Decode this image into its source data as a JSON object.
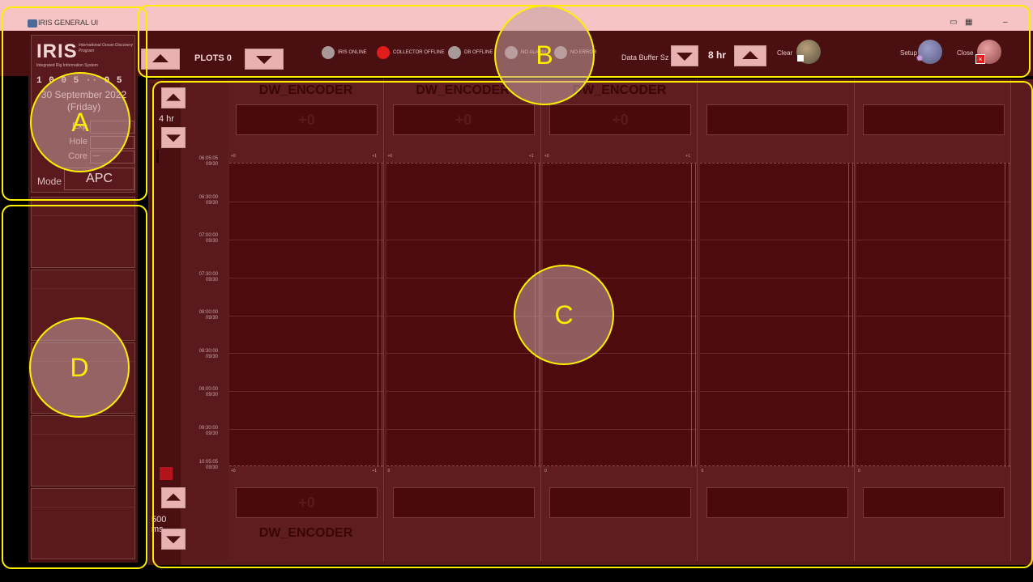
{
  "window": {
    "title": "IRIS GENERAL UI"
  },
  "topbar": {
    "plots_label": "PLOTS 0",
    "status": [
      {
        "label": "IRIS ONLINE",
        "color": "#a99a9a"
      },
      {
        "label": "COLLECTOR OFFLINE",
        "color": "#e21b1b"
      },
      {
        "label": "DB OFFLINE",
        "color": "#a99a9a"
      },
      {
        "label": "NO ALARM",
        "color": "#a99a9a"
      },
      {
        "label": "NO ERROR",
        "color": "#a99a9a"
      }
    ],
    "buffer_label": "Data Buffer Sz",
    "buffer_value": "8 hr",
    "clear_label": "Clear",
    "setup_label": "Setup",
    "close_label": "Close"
  },
  "info": {
    "logo": "IRIS",
    "logo_subtitle": "International Ocean Discovery Program",
    "logo_subtitle2": "Integrated Rig Information System",
    "clock": "1 0 0 5 ·· 0 5",
    "date": "30 September 2022",
    "day": "(Friday)",
    "fields": [
      {
        "label": "Exp",
        "value": ""
      },
      {
        "label": "Hole",
        "value": ""
      },
      {
        "label": "Core",
        "value": "---"
      }
    ],
    "mode_label": "Mode",
    "mode_value": "APC"
  },
  "plot_controls": {
    "time_range": "4 hr",
    "refresh": "500 ms"
  },
  "plots": {
    "columns": [
      {
        "title": "DW_ENCODER",
        "top_value": "+0",
        "bottom_value": "+0",
        "bottom_title": "DW_ENCODER",
        "scale_min": "+0",
        "scale_max": "+1",
        "bottom_min": "+0",
        "bottom_max": "+1"
      },
      {
        "title": "DW_ENCODER",
        "top_value": "+0",
        "bottom_value": "",
        "bottom_title": "",
        "scale_min": "+0",
        "scale_max": "+1",
        "bottom_min": "0",
        "bottom_max": ""
      },
      {
        "title": "DW_ENCODER",
        "top_value": "+0",
        "bottom_value": "",
        "bottom_title": "",
        "scale_min": "+0",
        "scale_max": "+1",
        "bottom_min": "0",
        "bottom_max": ""
      },
      {
        "title": "",
        "top_value": "",
        "bottom_value": "",
        "bottom_title": "",
        "scale_min": "",
        "scale_max": "",
        "bottom_min": "0",
        "bottom_max": ""
      },
      {
        "title": "",
        "top_value": "",
        "bottom_value": "",
        "bottom_title": "",
        "scale_min": "",
        "scale_max": "",
        "bottom_min": "0",
        "bottom_max": ""
      }
    ],
    "time_ticks": [
      {
        "time": "06:05:05",
        "date": "09/30"
      },
      {
        "time": "06:30:00",
        "date": "09/30"
      },
      {
        "time": "07:00:00",
        "date": "09/30"
      },
      {
        "time": "07:30:00",
        "date": "09/30"
      },
      {
        "time": "08:00:00",
        "date": "09/30"
      },
      {
        "time": "08:30:00",
        "date": "09/30"
      },
      {
        "time": "09:00:00",
        "date": "09/30"
      },
      {
        "time": "09:30:00",
        "date": "09/30"
      },
      {
        "time": "10:05:05",
        "date": "09/30"
      }
    ]
  },
  "annotations": [
    {
      "label": "A"
    },
    {
      "label": "B"
    },
    {
      "label": "C"
    },
    {
      "label": "D"
    }
  ]
}
